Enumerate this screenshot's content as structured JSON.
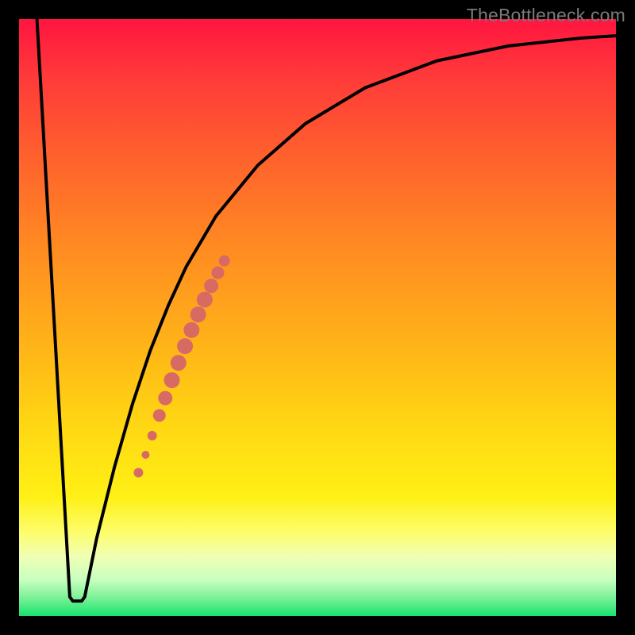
{
  "attribution": "TheBottleneck.com",
  "colors": {
    "frame": "#000000",
    "curve_stroke": "#000000",
    "marker": "#d86a64"
  },
  "chart_data": {
    "type": "line",
    "title": "",
    "xlabel": "",
    "ylabel": "",
    "xlim": [
      0,
      100
    ],
    "ylim": [
      0,
      100
    ],
    "curve": [
      {
        "x": 3.0,
        "y": 100.0
      },
      {
        "x": 8.5,
        "y": 3.2
      },
      {
        "x": 9.0,
        "y": 2.5
      },
      {
        "x": 10.5,
        "y": 2.5
      },
      {
        "x": 11.0,
        "y": 3.2
      },
      {
        "x": 13.0,
        "y": 13.0
      },
      {
        "x": 16.0,
        "y": 25.0
      },
      {
        "x": 19.0,
        "y": 35.5
      },
      {
        "x": 22.0,
        "y": 44.5
      },
      {
        "x": 25.0,
        "y": 52.0
      },
      {
        "x": 28.0,
        "y": 58.5
      },
      {
        "x": 33.0,
        "y": 67.0
      },
      {
        "x": 40.0,
        "y": 75.5
      },
      {
        "x": 48.0,
        "y": 82.5
      },
      {
        "x": 58.0,
        "y": 88.5
      },
      {
        "x": 70.0,
        "y": 93.0
      },
      {
        "x": 82.0,
        "y": 95.5
      },
      {
        "x": 94.0,
        "y": 96.8
      },
      {
        "x": 100.0,
        "y": 97.2
      }
    ],
    "markers": [
      {
        "x": 20.0,
        "y": 24.0,
        "r": 6
      },
      {
        "x": 21.2,
        "y": 27.0,
        "r": 5
      },
      {
        "x": 22.3,
        "y": 30.2,
        "r": 6
      },
      {
        "x": 23.5,
        "y": 33.6,
        "r": 8
      },
      {
        "x": 24.5,
        "y": 36.5,
        "r": 9
      },
      {
        "x": 25.6,
        "y": 39.5,
        "r": 10
      },
      {
        "x": 26.7,
        "y": 42.4,
        "r": 10
      },
      {
        "x": 27.8,
        "y": 45.2,
        "r": 10
      },
      {
        "x": 28.9,
        "y": 47.9,
        "r": 10
      },
      {
        "x": 30.0,
        "y": 50.5,
        "r": 10
      },
      {
        "x": 31.1,
        "y": 53.0,
        "r": 10
      },
      {
        "x": 32.2,
        "y": 55.3,
        "r": 9
      },
      {
        "x": 33.3,
        "y": 57.5,
        "r": 8
      },
      {
        "x": 34.4,
        "y": 59.5,
        "r": 7
      }
    ],
    "annotations": []
  }
}
